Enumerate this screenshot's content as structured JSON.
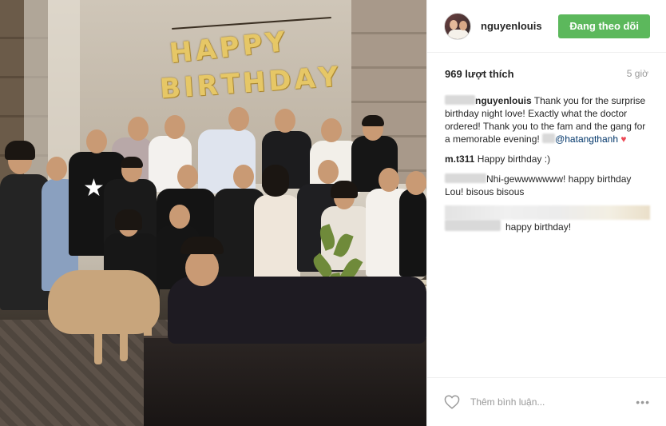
{
  "post": {
    "photo_alt": "",
    "balloons": [
      "H",
      "A",
      "P",
      "P",
      "Y",
      "B",
      "I",
      "R",
      "T",
      "H",
      "D",
      "A",
      "Y"
    ]
  },
  "header": {
    "username": "nguyenlouis",
    "follow_label": "Đang theo dõi"
  },
  "meta": {
    "likes": "969 lượt thích",
    "time": "5 giờ"
  },
  "comments": [
    {
      "user": "nguyenlouis",
      "text": "Thank you for the surprise birthday night love! Exactly what the doctor ordered! Thank you to the fam and the gang for a memorable evening!",
      "mention": "@hatangthanh",
      "emoji": "♥"
    },
    {
      "user": "m.t311",
      "text": "Happy birthday :)"
    },
    {
      "user": "",
      "text": "Nhi-gewwwwwww! happy birthday Lou! bisous bisous"
    },
    {
      "user": "",
      "text": "happy birthday!"
    }
  ],
  "footer": {
    "comment_placeholder": "Thêm bình luận...",
    "more": "•••"
  },
  "colors": {
    "follow_button": "#5cb85c",
    "heart": "#ed4956"
  },
  "icons": [
    "heart-outline-icon",
    "more-options-icon"
  ]
}
